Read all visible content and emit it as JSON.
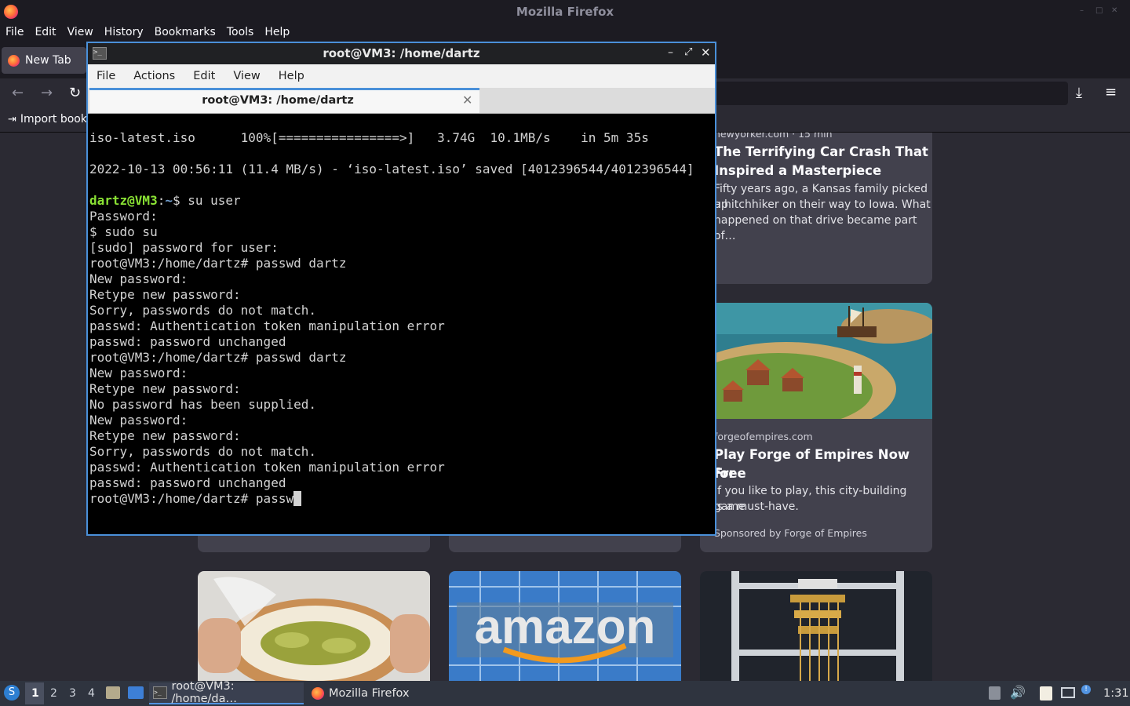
{
  "firefox": {
    "window_title": "Mozilla Firefox",
    "menu": [
      "File",
      "Edit",
      "View",
      "History",
      "Bookmarks",
      "Tools",
      "Help"
    ],
    "tab_label": "New Tab",
    "import_bookmarks": "Import book",
    "cards": [
      {
        "source": "newyorker.com · 15 min",
        "title_line1": "The Terrifying Car Crash That",
        "title_line2": "Inspired a Masterpiece",
        "desc_line1": "Fifty years ago, a Kansas family picked up",
        "desc_line2": "a hitchhiker on their way to Iowa. What",
        "desc_line3": "happened on that drive became part of…"
      },
      {
        "source": "forgeofempires.com",
        "title_line1": "Play Forge of Empires Now for",
        "title_line2": "Free",
        "desc_line1": "If you like to play, this city-building game",
        "desc_line2": "is a must-have.",
        "sponsor": "Sponsored by Forge of Empires"
      }
    ]
  },
  "terminal": {
    "window_title": "root@VM3: /home/dartz",
    "menu": [
      "File",
      "Actions",
      "Edit",
      "View",
      "Help"
    ],
    "tab_label": "root@VM3: /home/dartz",
    "tab_close": "✕",
    "lines": {
      "l1": "iso-latest.iso      100%[================>]   3.74G  10.1MB/s    in 5m 35s",
      "l2": "2022-10-13 00:56:11 (11.4 MB/s) - ‘iso-latest.iso’ saved [4012396544/4012396544]",
      "prompt_user": "dartz@VM3",
      "prompt_path": "~",
      "l4_cmd": "$ su user",
      "rest": "Password:\n$ sudo su\n[sudo] password for user:\nroot@VM3:/home/dartz# passwd dartz\nNew password:\nRetype new password:\nSorry, passwords do not match.\npasswd: Authentication token manipulation error\npasswd: password unchanged\nroot@VM3:/home/dartz# passwd dartz\nNew password:\nRetype new password:\nNo password has been supplied.\nNew password:\nRetype new password:\nSorry, passwords do not match.\npasswd: Authentication token manipulation error\npasswd: password unchanged",
      "current": "root@VM3:/home/dartz# passw"
    }
  },
  "taskbar": {
    "workspaces": [
      "1",
      "2",
      "3",
      "4"
    ],
    "active_workspace": "1",
    "tasks": [
      {
        "label": "root@VM3: /home/da…",
        "active": true
      },
      {
        "label": "Mozilla Firefox",
        "active": false
      }
    ],
    "clock": "1:31"
  }
}
